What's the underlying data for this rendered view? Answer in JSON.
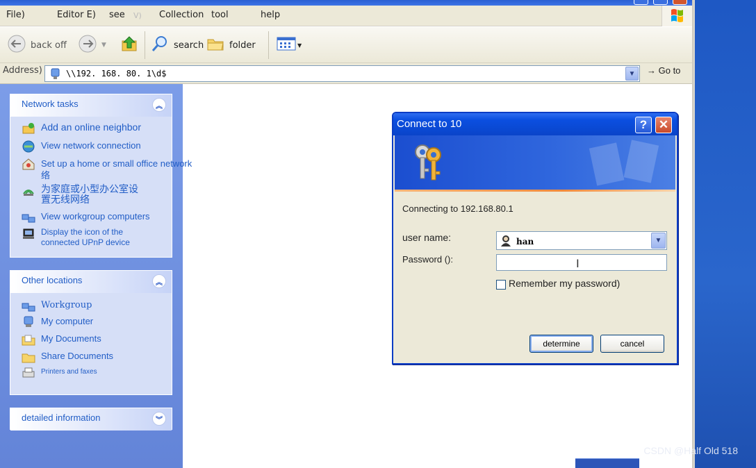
{
  "menu": {
    "items": [
      "File)",
      "Editor E)",
      "see",
      "Collection",
      "tool",
      "help"
    ]
  },
  "toolbar": {
    "back_label": "back off",
    "search_label": "search",
    "folder_label": "folder"
  },
  "address": {
    "label": "Address)",
    "value": "\\\\192. 168. 80. 1\\d$",
    "go_label": "→ Go to"
  },
  "sidebar": {
    "network_tasks": {
      "title": "Network tasks",
      "items": [
        "Add an online neighbor",
        "View network connection",
        "Set up a home or small office network",
        "络",
        "为家庭或小型办公室设",
        "置无线网络",
        "View workgroup computers",
        "Display the icon of the",
        "connected UPnP device"
      ]
    },
    "other_locations": {
      "title": "Other locations",
      "items": [
        "Workgroup",
        "My computer",
        "My Documents",
        "Share Documents",
        "Printers and faxes"
      ]
    },
    "details": {
      "title": "detailed information"
    }
  },
  "dialog": {
    "title": "Connect to 10",
    "connecting_text": "Connecting to 192.168.80.1",
    "username_label": "user name:",
    "username_value": "han",
    "password_label": "Password ():",
    "password_value": "",
    "remember_label": "Remember my password)",
    "remember_checked": false,
    "ok_label": "determine",
    "cancel_label": "cancel"
  },
  "watermark": "CSDN @Half Old 518",
  "colors": {
    "accent_blue": "#215dc6",
    "titlebar_blue": "#0a44c9",
    "taskpane_bg": "#6384d8"
  }
}
